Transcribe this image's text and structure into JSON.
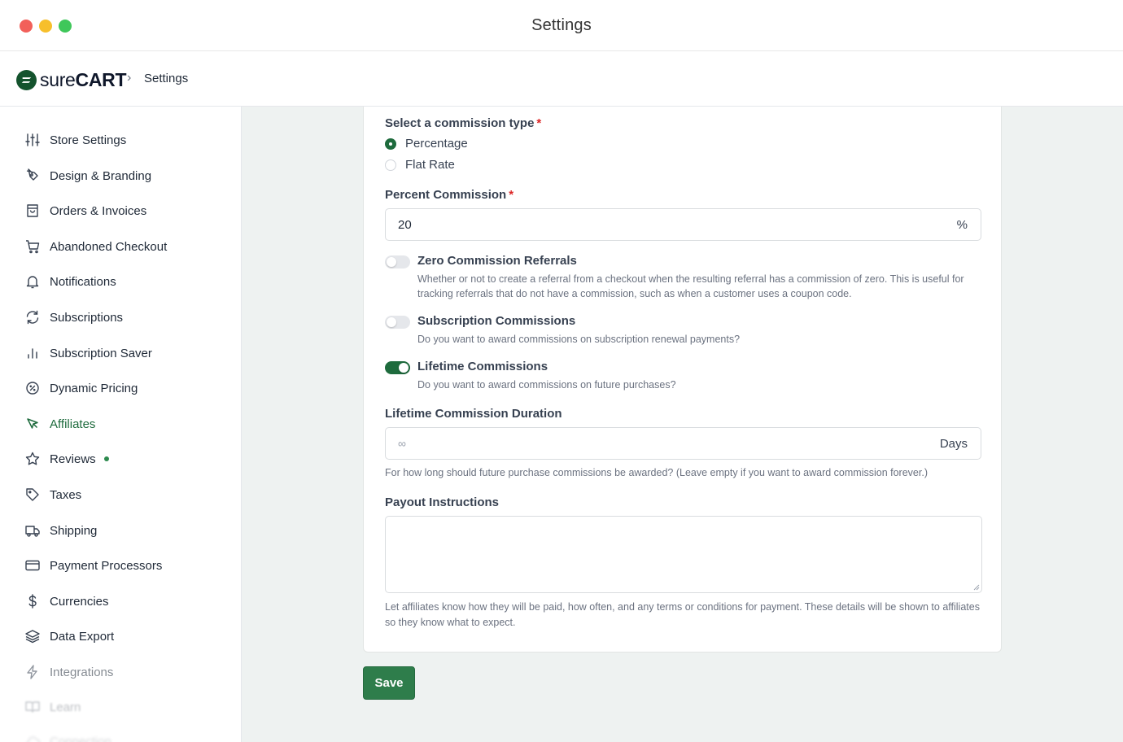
{
  "window": {
    "title": "Settings"
  },
  "header": {
    "logo_text_light": "sure",
    "logo_text_bold": "CART",
    "breadcrumb_separator": "›",
    "breadcrumb": "Settings"
  },
  "sidebar": {
    "items": [
      {
        "label": "Store Settings",
        "icon": "sliders-icon"
      },
      {
        "label": "Design & Branding",
        "icon": "pen-brush-icon"
      },
      {
        "label": "Orders & Invoices",
        "icon": "shopping-bag-icon"
      },
      {
        "label": "Abandoned Checkout",
        "icon": "shopping-cart-icon"
      },
      {
        "label": "Notifications",
        "icon": "bell-icon"
      },
      {
        "label": "Subscriptions",
        "icon": "refresh-icon"
      },
      {
        "label": "Subscription Saver",
        "icon": "bar-chart-icon"
      },
      {
        "label": "Dynamic Pricing",
        "icon": "percent-badge-icon"
      },
      {
        "label": "Affiliates",
        "icon": "cursor-arrow-icon"
      },
      {
        "label": "Reviews",
        "icon": "star-icon"
      },
      {
        "label": "Taxes",
        "icon": "tag-icon"
      },
      {
        "label": "Shipping",
        "icon": "truck-icon"
      },
      {
        "label": "Payment Processors",
        "icon": "credit-card-icon"
      },
      {
        "label": "Currencies",
        "icon": "dollar-icon"
      },
      {
        "label": "Data Export",
        "icon": "layers-icon"
      },
      {
        "label": "Integrations",
        "icon": "lightning-icon"
      },
      {
        "label": "Learn",
        "icon": "book-icon"
      },
      {
        "label": "Connection",
        "icon": "cloud-icon"
      }
    ],
    "active_item": "Affiliates"
  },
  "form": {
    "commission_type": {
      "label": "Select a commission type",
      "required_mark": "*",
      "options": [
        "Percentage",
        "Flat Rate"
      ],
      "selected": "Percentage"
    },
    "percent_commission": {
      "label": "Percent Commission",
      "required_mark": "*",
      "value": "20",
      "suffix": "%"
    },
    "zero_commission": {
      "title": "Zero Commission Referrals",
      "help": "Whether or not to create a referral from a checkout when the resulting referral has a commission of zero. This is useful for tracking referrals that do not have a commission, such as when a customer uses a coupon code.",
      "enabled": false
    },
    "subscription_commissions": {
      "title": "Subscription Commissions",
      "help": "Do you want to award commissions on subscription renewal payments?",
      "enabled": false
    },
    "lifetime_commissions": {
      "title": "Lifetime Commissions",
      "help": "Do you want to award commissions on future purchases?",
      "enabled": true
    },
    "lifetime_duration": {
      "label": "Lifetime Commission Duration",
      "placeholder": "∞",
      "suffix": "Days",
      "help": "For how long should future purchase commissions be awarded? (Leave empty if you want to award commission forever.)"
    },
    "payout_instructions": {
      "label": "Payout Instructions",
      "value": "",
      "help": "Let affiliates know how they will be paid, how often, and any terms or conditions for payment. These details will be shown to affiliates so they know what to expect."
    }
  },
  "actions": {
    "save_label": "Save"
  },
  "colors": {
    "accent": "#1e6b3d",
    "button": "#2e7d4b",
    "background": "#eef2f1"
  }
}
